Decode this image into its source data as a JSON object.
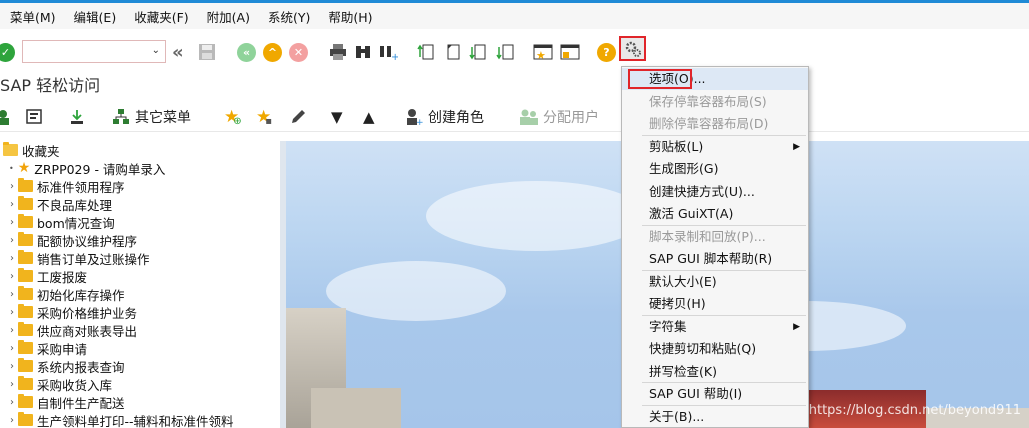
{
  "menubar": {
    "items": [
      "菜单(M)",
      "编辑(E)",
      "收藏夹(F)",
      "附加(A)",
      "系统(Y)",
      "帮助(H)"
    ]
  },
  "command_field": {
    "value": ""
  },
  "title": "SAP 轻松访问",
  "app_toolbar": {
    "other_menu": "其它菜单",
    "create_role": "创建角色",
    "assign_user": "分配用户"
  },
  "tree": {
    "root": "收藏夹",
    "favorite": "ZRPP029 - 请购单录入",
    "folders": [
      "标准件领用程序",
      "不良品库处理",
      "bom情况查询",
      "配额协议维护程序",
      "销售订单及过账操作",
      "工废报废",
      "初始化库存操作",
      "采购价格维护业务",
      "供应商对账表导出",
      "采购申请",
      "系统内报表查询",
      "采购收货入库",
      "自制件生产配送",
      "生产领料单打印--辅料和标准件领料"
    ]
  },
  "context_menu": {
    "items": [
      {
        "label": "选项(O)...",
        "disabled": false,
        "submenu": false,
        "highlight": true
      },
      {
        "label": "保存停靠容器布局(S)",
        "disabled": true,
        "submenu": false
      },
      {
        "label": "删除停靠容器布局(D)",
        "disabled": true,
        "submenu": false,
        "sep_after": true
      },
      {
        "label": "剪贴板(L)",
        "disabled": false,
        "submenu": true
      },
      {
        "label": "生成图形(G)",
        "disabled": false,
        "submenu": false
      },
      {
        "label": "创建快捷方式(U)...",
        "disabled": false,
        "submenu": false
      },
      {
        "label": "激活 GuiXT(A)",
        "disabled": false,
        "submenu": false,
        "sep_after": true
      },
      {
        "label": "脚本录制和回放(P)...",
        "disabled": true,
        "submenu": false
      },
      {
        "label": "SAP GUI 脚本帮助(R)",
        "disabled": false,
        "submenu": false,
        "sep_after": true
      },
      {
        "label": "默认大小(E)",
        "disabled": false,
        "submenu": false
      },
      {
        "label": "硬拷贝(H)",
        "disabled": false,
        "submenu": false,
        "sep_after": true
      },
      {
        "label": "字符集",
        "disabled": false,
        "submenu": true
      },
      {
        "label": "快捷剪切和粘贴(Q)",
        "disabled": false,
        "submenu": false
      },
      {
        "label": "拼写检查(K)",
        "disabled": false,
        "submenu": false,
        "sep_after": true
      },
      {
        "label": "SAP GUI 帮助(I)",
        "disabled": false,
        "submenu": false,
        "sep_after": true
      },
      {
        "label": "关于(B)...",
        "disabled": false,
        "submenu": false
      }
    ]
  },
  "watermark": "https://blog.csdn.net/beyond911",
  "colors": {
    "accent": "#1f8ad6",
    "folder": "#f1b41d",
    "highlight_box": "#e0252a"
  }
}
